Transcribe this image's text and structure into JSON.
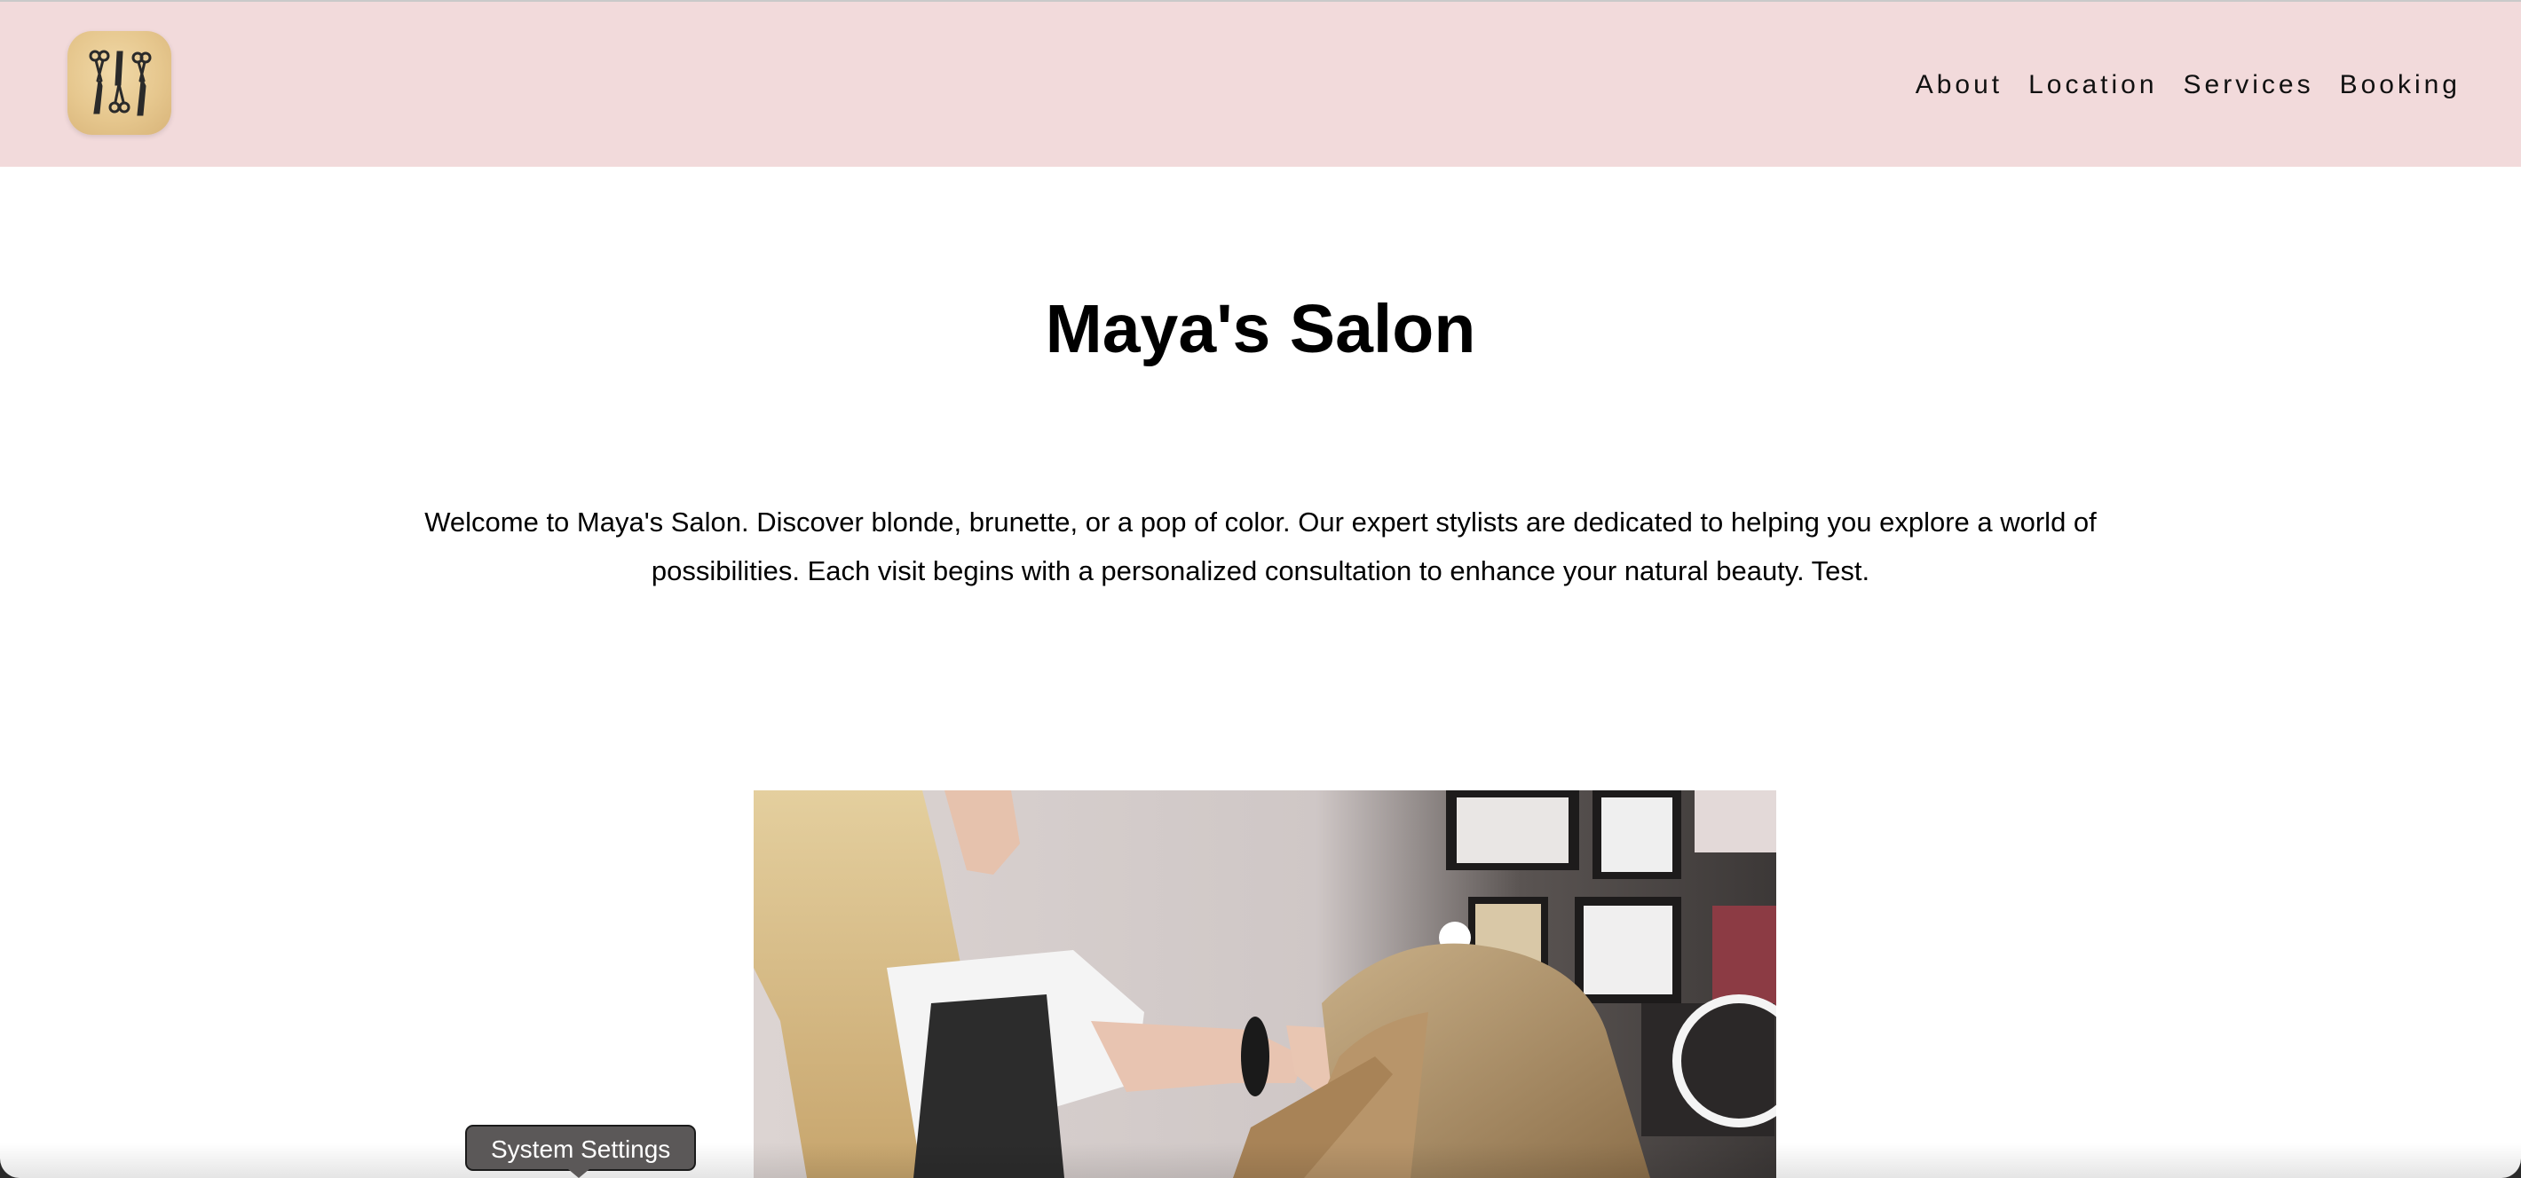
{
  "header": {
    "logo_icon": "scissors-icon",
    "nav": [
      {
        "label": "About"
      },
      {
        "label": "Location"
      },
      {
        "label": "Services"
      },
      {
        "label": "Booking"
      }
    ]
  },
  "main": {
    "title": "Maya's Salon",
    "intro": "Welcome to Maya's Salon. Discover blonde, brunette, or a pop of color. Our expert stylists are dedicated to helping you explore a world of possibilities. Each visit begins with a personalized consultation to enhance your natural beauty. Test."
  },
  "tooltip": {
    "label": "System Settings"
  },
  "colors": {
    "header_bg": "#f2dadb",
    "logo_bg": "#e6c78e",
    "text": "#000000",
    "tooltip_bg": "#5b5858"
  }
}
